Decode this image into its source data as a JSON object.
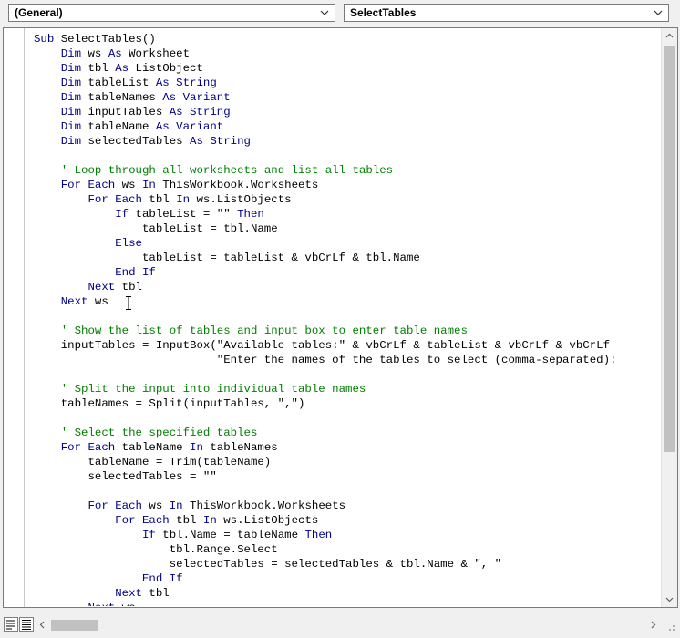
{
  "toolbar": {
    "object_dropdown": "(General)",
    "procedure_dropdown": "SelectTables"
  },
  "code_lines": [
    [
      {
        "t": "Sub ",
        "c": "kw"
      },
      {
        "t": "SelectTables()",
        "c": ""
      }
    ],
    [
      {
        "t": "    ",
        "c": ""
      },
      {
        "t": "Dim",
        "c": "kw"
      },
      {
        "t": " ws ",
        "c": ""
      },
      {
        "t": "As",
        "c": "kw"
      },
      {
        "t": " Worksheet",
        "c": ""
      }
    ],
    [
      {
        "t": "    ",
        "c": ""
      },
      {
        "t": "Dim",
        "c": "kw"
      },
      {
        "t": " tbl ",
        "c": ""
      },
      {
        "t": "As",
        "c": "kw"
      },
      {
        "t": " ListObject",
        "c": ""
      }
    ],
    [
      {
        "t": "    ",
        "c": ""
      },
      {
        "t": "Dim",
        "c": "kw"
      },
      {
        "t": " tableList ",
        "c": ""
      },
      {
        "t": "As String",
        "c": "kw"
      }
    ],
    [
      {
        "t": "    ",
        "c": ""
      },
      {
        "t": "Dim",
        "c": "kw"
      },
      {
        "t": " tableNames ",
        "c": ""
      },
      {
        "t": "As Variant",
        "c": "kw"
      }
    ],
    [
      {
        "t": "    ",
        "c": ""
      },
      {
        "t": "Dim",
        "c": "kw"
      },
      {
        "t": " inputTables ",
        "c": ""
      },
      {
        "t": "As String",
        "c": "kw"
      }
    ],
    [
      {
        "t": "    ",
        "c": ""
      },
      {
        "t": "Dim",
        "c": "kw"
      },
      {
        "t": " tableName ",
        "c": ""
      },
      {
        "t": "As Variant",
        "c": "kw"
      }
    ],
    [
      {
        "t": "    ",
        "c": ""
      },
      {
        "t": "Dim",
        "c": "kw"
      },
      {
        "t": " selectedTables ",
        "c": ""
      },
      {
        "t": "As String",
        "c": "kw"
      }
    ],
    [],
    [
      {
        "t": "    ",
        "c": ""
      },
      {
        "t": "' Loop through all worksheets and list all tables",
        "c": "cm"
      }
    ],
    [
      {
        "t": "    ",
        "c": ""
      },
      {
        "t": "For Each",
        "c": "kw"
      },
      {
        "t": " ws ",
        "c": ""
      },
      {
        "t": "In",
        "c": "kw"
      },
      {
        "t": " ThisWorkbook.Worksheets",
        "c": ""
      }
    ],
    [
      {
        "t": "        ",
        "c": ""
      },
      {
        "t": "For Each",
        "c": "kw"
      },
      {
        "t": " tbl ",
        "c": ""
      },
      {
        "t": "In",
        "c": "kw"
      },
      {
        "t": " ws.ListObjects",
        "c": ""
      }
    ],
    [
      {
        "t": "            ",
        "c": ""
      },
      {
        "t": "If",
        "c": "kw"
      },
      {
        "t": " tableList = \"\" ",
        "c": ""
      },
      {
        "t": "Then",
        "c": "kw"
      }
    ],
    [
      {
        "t": "                tableList = tbl.Name",
        "c": ""
      }
    ],
    [
      {
        "t": "            ",
        "c": ""
      },
      {
        "t": "Else",
        "c": "kw"
      }
    ],
    [
      {
        "t": "                tableList = tableList & vbCrLf & tbl.Name",
        "c": ""
      }
    ],
    [
      {
        "t": "            ",
        "c": ""
      },
      {
        "t": "End If",
        "c": "kw"
      }
    ],
    [
      {
        "t": "        ",
        "c": ""
      },
      {
        "t": "Next",
        "c": "kw"
      },
      {
        "t": " tbl",
        "c": ""
      }
    ],
    [
      {
        "t": "    ",
        "c": ""
      },
      {
        "t": "Next",
        "c": "kw"
      },
      {
        "t": " ws",
        "c": ""
      }
    ],
    [],
    [
      {
        "t": "    ",
        "c": ""
      },
      {
        "t": "' Show the list of tables and input box to enter table names",
        "c": "cm"
      }
    ],
    [
      {
        "t": "    inputTables = InputBox(\"Available tables:\" & vbCrLf & tableList & vbCrLf & vbCrLf",
        "c": ""
      }
    ],
    [
      {
        "t": "                           \"Enter the names of the tables to select (comma-separated):",
        "c": ""
      }
    ],
    [],
    [
      {
        "t": "    ",
        "c": ""
      },
      {
        "t": "' Split the input into individual table names",
        "c": "cm"
      }
    ],
    [
      {
        "t": "    tableNames = Split(inputTables, \",\")",
        "c": ""
      }
    ],
    [],
    [
      {
        "t": "    ",
        "c": ""
      },
      {
        "t": "' Select the specified tables",
        "c": "cm"
      }
    ],
    [
      {
        "t": "    ",
        "c": ""
      },
      {
        "t": "For Each",
        "c": "kw"
      },
      {
        "t": " tableName ",
        "c": ""
      },
      {
        "t": "In",
        "c": "kw"
      },
      {
        "t": " tableNames",
        "c": ""
      }
    ],
    [
      {
        "t": "        tableName = Trim(tableName)",
        "c": ""
      }
    ],
    [
      {
        "t": "        selectedTables = \"\"",
        "c": ""
      }
    ],
    [],
    [
      {
        "t": "        ",
        "c": ""
      },
      {
        "t": "For Each",
        "c": "kw"
      },
      {
        "t": " ws ",
        "c": ""
      },
      {
        "t": "In",
        "c": "kw"
      },
      {
        "t": " ThisWorkbook.Worksheets",
        "c": ""
      }
    ],
    [
      {
        "t": "            ",
        "c": ""
      },
      {
        "t": "For Each",
        "c": "kw"
      },
      {
        "t": " tbl ",
        "c": ""
      },
      {
        "t": "In",
        "c": "kw"
      },
      {
        "t": " ws.ListObjects",
        "c": ""
      }
    ],
    [
      {
        "t": "                ",
        "c": ""
      },
      {
        "t": "If",
        "c": "kw"
      },
      {
        "t": " tbl.Name = tableName ",
        "c": ""
      },
      {
        "t": "Then",
        "c": "kw"
      }
    ],
    [
      {
        "t": "                    tbl.Range.Select",
        "c": ""
      }
    ],
    [
      {
        "t": "                    selectedTables = selectedTables & tbl.Name & \", \"",
        "c": ""
      }
    ],
    [
      {
        "t": "                ",
        "c": ""
      },
      {
        "t": "End If",
        "c": "kw"
      }
    ],
    [
      {
        "t": "            ",
        "c": ""
      },
      {
        "t": "Next",
        "c": "kw"
      },
      {
        "t": " tbl",
        "c": ""
      }
    ],
    [
      {
        "t": "        ",
        "c": ""
      },
      {
        "t": "Next",
        "c": "kw"
      },
      {
        "t": " ws",
        "c": ""
      }
    ]
  ],
  "icons": {
    "dropdown": "chevron-down-icon",
    "scroll_up": "scroll-up-arrow-icon",
    "scroll_down": "scroll-down-arrow-icon",
    "scroll_left": "scroll-left-arrow-icon",
    "scroll_right": "scroll-right-arrow-icon",
    "procedure_view": "procedure-view-icon",
    "full_module_view": "full-module-view-icon",
    "text_cursor": "i-beam-cursor-icon"
  },
  "colors": {
    "keyword": "#00008b",
    "comment": "#008000",
    "text": "#000000"
  }
}
